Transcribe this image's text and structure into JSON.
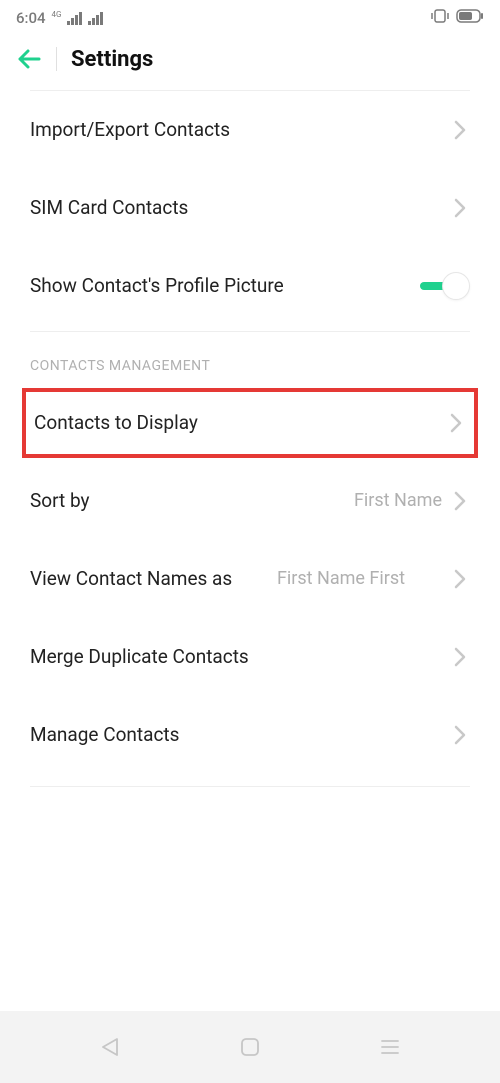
{
  "statusbar": {
    "time": "6:04",
    "net_label": "4G"
  },
  "header": {
    "title": "Settings"
  },
  "rows": {
    "import_export": "Import/Export Contacts",
    "sim": "SIM Card Contacts",
    "profile_pic": "Show Contact's Profile Picture"
  },
  "section_contacts_mgmt": "CONTACTS MANAGEMENT",
  "mgmt": {
    "contacts_to_display": "Contacts to Display",
    "sort_by": "Sort by",
    "sort_by_value": "First Name",
    "view_names_as": "View Contact Names as",
    "view_names_value": "First Name First",
    "merge_dup": "Merge Duplicate Contacts",
    "manage": "Manage Contacts"
  },
  "toggle": {
    "profile_pic_on": true
  }
}
